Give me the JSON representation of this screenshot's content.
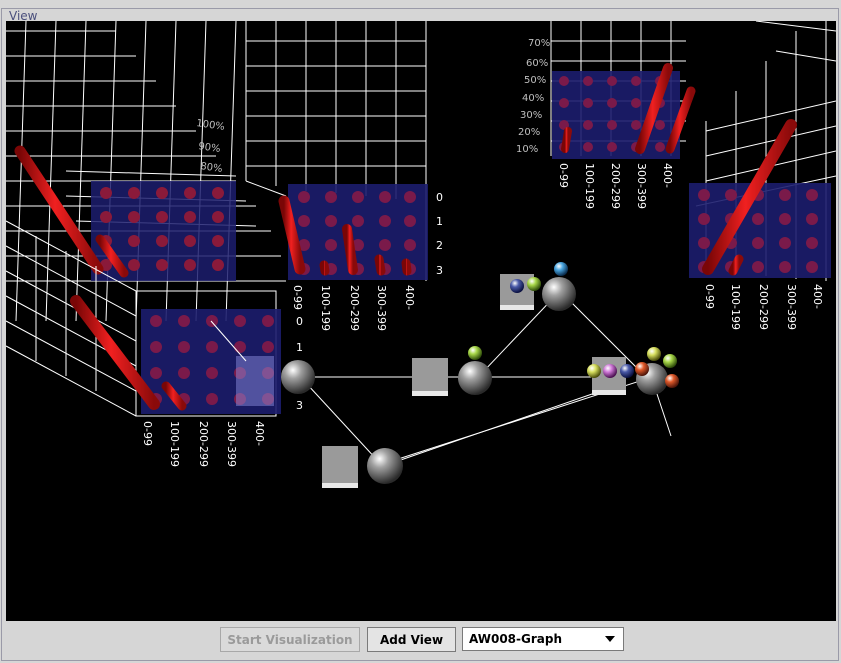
{
  "panel": {
    "title": "View"
  },
  "toolbar": {
    "start_label": "Start Visualization",
    "add_view_label": "Add View",
    "graph_select_value": "AW008-Graph"
  },
  "chart_grids": {
    "x_labels": [
      "0-99",
      "100-199",
      "200-299",
      "300-399",
      "400-"
    ],
    "y_labels": [
      "0",
      "1",
      "2",
      "3"
    ],
    "pct_labels": [
      "100%",
      "90%",
      "80%",
      "70%",
      "60%",
      "50%",
      "40%",
      "30%",
      "20%",
      "10%"
    ]
  },
  "colors": {
    "grid_face": "#1c1d6e",
    "bar": "#e01818",
    "node": "#9a9a9a",
    "wire": "#ffffff"
  }
}
